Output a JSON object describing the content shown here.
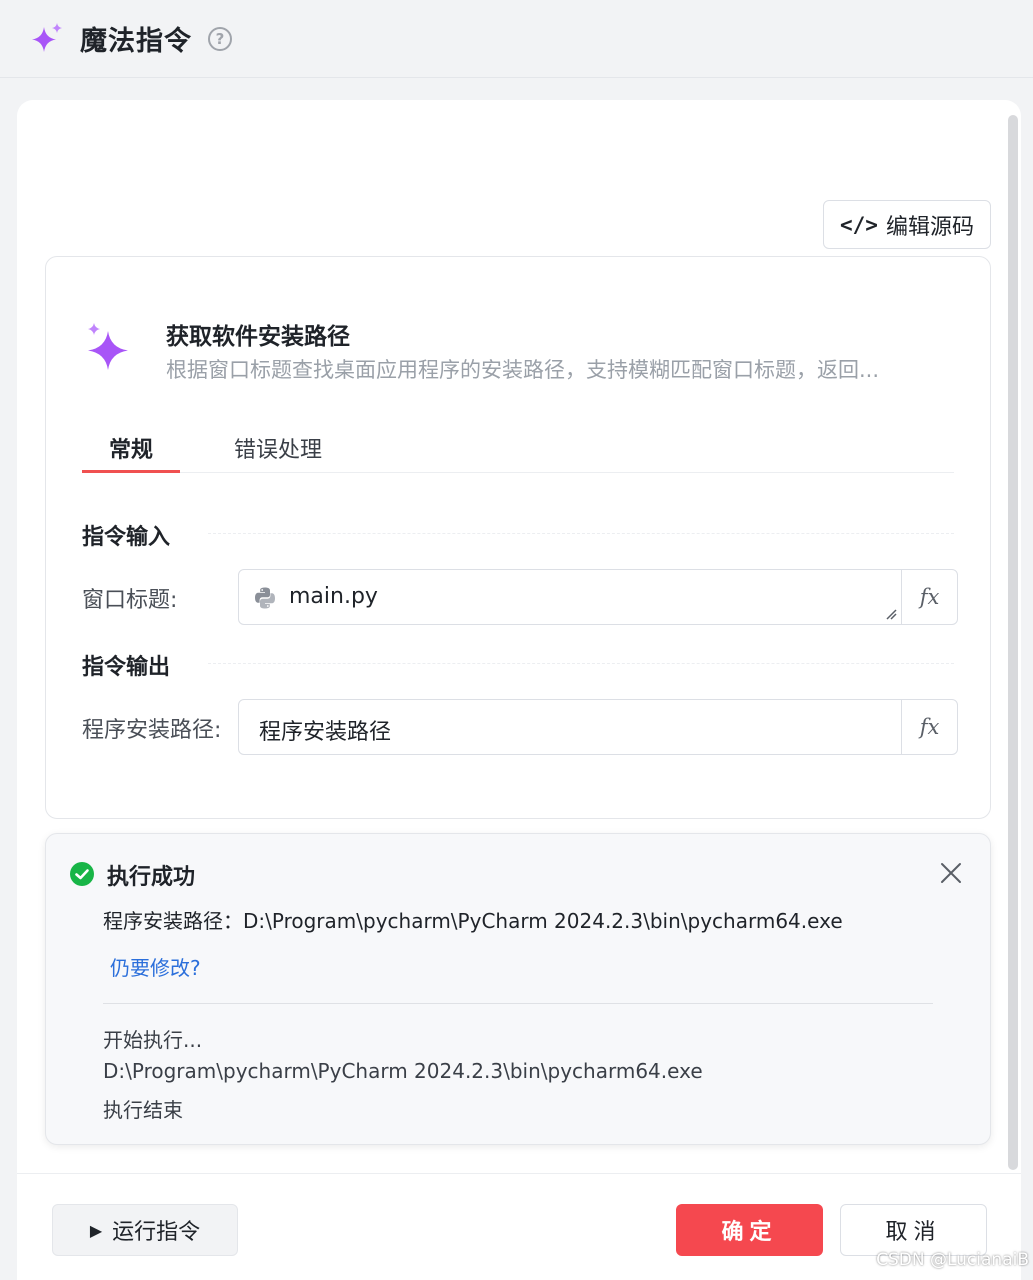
{
  "header": {
    "title": "魔法指令",
    "help_icon": "question-circle-icon",
    "help_glyph": "?"
  },
  "toolbar": {
    "edit_source_label": "编辑源码",
    "code_glyph": "</>"
  },
  "command": {
    "title": "获取软件安装路径",
    "description": "根据窗口标题查找桌面应用程序的安装路径，支持模糊匹配窗口标题，返回..."
  },
  "tabs": [
    {
      "label": "常规",
      "active": true
    },
    {
      "label": "错误处理",
      "active": false
    }
  ],
  "input_section": {
    "title": "指令输入",
    "fields": [
      {
        "label": "窗口标题:",
        "value": "main.py",
        "icon": "python-icon"
      }
    ]
  },
  "output_section": {
    "title": "指令输出",
    "fields": [
      {
        "label": "程序安装路径:",
        "value": "程序安装路径"
      }
    ]
  },
  "fx_label": "fx",
  "result": {
    "status": "执行成功",
    "output_line": "程序安装路径：D:\\Program\\pycharm\\PyCharm 2024.2.3\\bin\\pycharm64.exe",
    "modify_link": "仍要修改?",
    "log": [
      "开始执行...",
      "D:\\Program\\pycharm\\PyCharm 2024.2.3\\bin\\pycharm64.exe",
      "执行结束"
    ]
  },
  "footer": {
    "run_label": "运行指令",
    "play_glyph": "▶",
    "confirm_label": "确定",
    "cancel_label": "取消"
  },
  "watermark": "CSDN @LucianaiB",
  "colors": {
    "accent": "#f5484f",
    "sparkle": "#a855f7",
    "success": "#18b547",
    "link": "#2b6fdb"
  }
}
